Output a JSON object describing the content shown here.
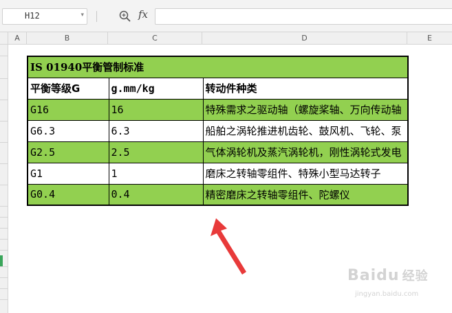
{
  "formula_bar": {
    "cell_ref": "H12",
    "fx_label": "fx",
    "formula_value": ""
  },
  "columns": [
    "A",
    "B",
    "C",
    "D",
    "E"
  ],
  "table": {
    "title": "IS 01940平衡管制标准",
    "headers": [
      "平衡等级G",
      "g.mm/kg",
      "转动件种类"
    ],
    "rows": [
      {
        "grade": "G16",
        "value": "16",
        "type": "特殊需求之驱动轴（螺旋桨轴、万向传动轴"
      },
      {
        "grade": "G6.3",
        "value": "6.3",
        "type": "船舶之涡轮推进机齿轮、鼓风机、飞轮、泵"
      },
      {
        "grade": "G2.5",
        "value": "2.5",
        "type": "气体涡轮机及蒸汽涡轮机，刚性涡轮式发电"
      },
      {
        "grade": "G1",
        "value": "1",
        "type": "磨床之转轴零组件、特殊小型马达转子"
      },
      {
        "grade": "G0.4",
        "value": "0.4",
        "type": "精密磨床之转轴零组件、陀螺仪"
      }
    ]
  },
  "colors": {
    "green_fill": "#92d050",
    "arrow": "#e83a3a"
  },
  "watermark": {
    "brand": "Baidu",
    "brand_cn": "经验",
    "url": "jingyan.baidu.com"
  }
}
